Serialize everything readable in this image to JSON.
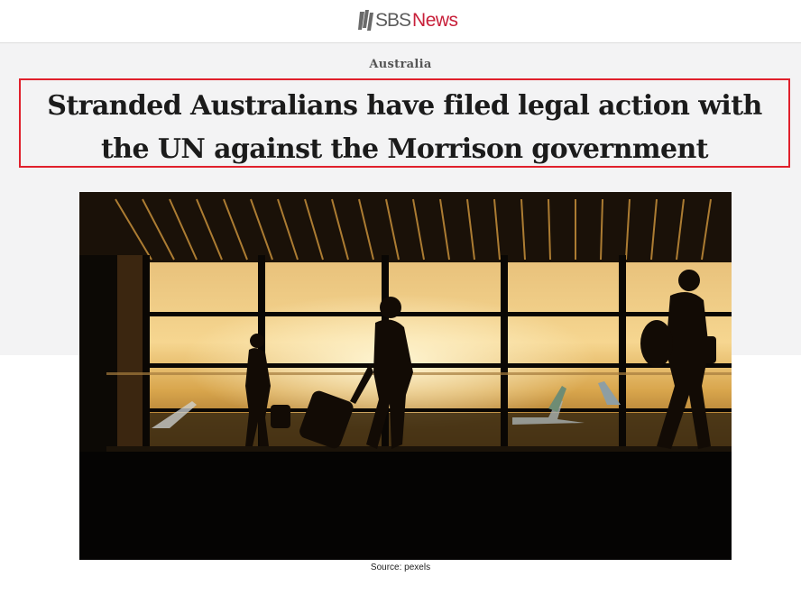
{
  "site": {
    "logo_sbs": "SBS",
    "logo_news": "News",
    "brand_color": "#c8203a"
  },
  "article": {
    "category": "Australia",
    "headline": "Stranded Australians have filed legal action with the UN against the Morrison government",
    "image_caption": "Source: pexels",
    "highlight_color": "#e0202c"
  },
  "icons": {
    "logo": "sbs-logo-mark-icon"
  }
}
